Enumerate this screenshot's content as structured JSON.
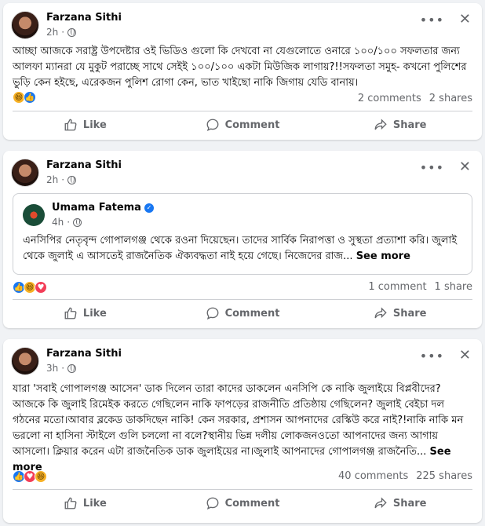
{
  "posts": [
    {
      "author": "Farzana Sithi",
      "time": "2h",
      "text": "আচ্ছা আজকে সরাষ্ট্র উপদেষ্টার ওই ভিডিও গুলো কি দেখবো না যেগুলোতে ওনারে ১০০/১০০ সফলতার জন্য আলফা ম্যানরা যে মুকুট পরাচ্ছে সাথে সেইই ১০০/১০০ একটা মিউজিক লাগায়?!!সফলতা সমুহ- কখনো পুলিশের ভুড়ি কেন হইছে, এরেকজন পুলিশ রোগা কেন, ভাত খাইছো নাকি জিগায় যেডি বানায়।",
      "reactions": [
        "haha",
        "like"
      ],
      "comments": "2 comments",
      "shares": "2 shares"
    },
    {
      "author": "Farzana Sithi",
      "time": "2h",
      "shared": {
        "author": "Umama Fatema",
        "time": "4h",
        "text": "এনসিপির নেতৃবৃন্দ গোপালগঞ্জ থেকে রওনা দিয়েছেন। তাদের সার্বিক নিরাপত্তা ও সুস্থতা প্রত্যাশা করি। জুলাই থেকে জুলাই এ আসতেই রাজনৈতিক ঐক্যবদ্ধতা নাই হয়ে গেছে। নিজেদের রাজ...",
        "see_more": "See more"
      },
      "reactions": [
        "like",
        "haha",
        "love"
      ],
      "comments": "1 comment",
      "shares": "1 share"
    },
    {
      "author": "Farzana Sithi",
      "time": "3h",
      "text": "যারা 'সবাই গোপালগঞ্জ আসেন' ডাক দিলেন তারা কাদের ডাকলেন এনসিপি কে নাকি জুলাইয়ে বিপ্লবীদের? আজকে কি জুলাই রিমেইক করতে গেছিলেন নাকি ফাপড়ের রাজনীতি প্রতিষ্ঠায় গেছিলেন? জুলাই বেইচা দল গঠনের মতো।আবার ব্লকেড ডাকদিছেন নাকি! কেন সরকার, প্রশাসন আপনাদের রেস্কিউ করে নাই?!নাকি নাকি মন ভরলো না হাসিনা স্টাইলে গুলি চললো না বলে?স্থানীয় ভিন্ন দলীয় লোকজনওতো আপনাদের জন্য আগায় আসলো। ক্লিয়ার করেন এটা রাজনৈতিক ডাক জুলাইয়ের না।জুলাই আপনাদের গোপালগঞ্জ রাজনৈতি...",
      "see_more": "See more",
      "reactions": [
        "like",
        "love",
        "haha"
      ],
      "comments": "40 comments",
      "shares": "225 shares"
    }
  ],
  "actions": {
    "like": "Like",
    "comment": "Comment",
    "share": "Share"
  },
  "icons": {
    "more": "more-icon",
    "close": "close-icon",
    "globe": "globe-icon"
  },
  "colors": {
    "like_blue": "#1877f2",
    "love_red": "#f33e58",
    "haha_yellow": "#f7b125",
    "muted": "#65676b"
  }
}
